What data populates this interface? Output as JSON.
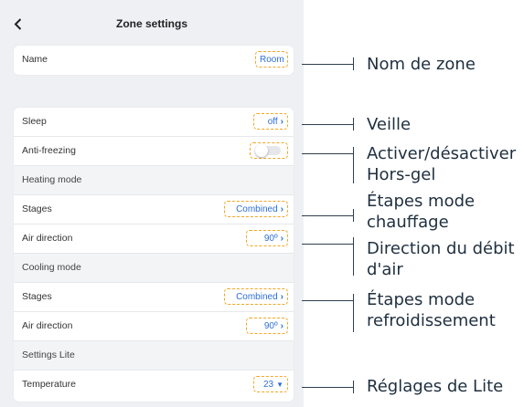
{
  "header": {
    "title": "Zone settings",
    "back_icon": "chevron-left-icon"
  },
  "name_row": {
    "label": "Name",
    "value": "Room"
  },
  "sleep": {
    "label": "Sleep",
    "value": "off"
  },
  "antifreeze": {
    "label": "Anti-freezing",
    "on": false
  },
  "heating": {
    "section": "Heating mode",
    "stages": {
      "label": "Stages",
      "value": "Combined"
    },
    "air": {
      "label": "Air direction",
      "value": "90º"
    }
  },
  "cooling": {
    "section": "Cooling mode",
    "stages": {
      "label": "Stages",
      "value": "Combined"
    },
    "air": {
      "label": "Air direction",
      "value": "90º"
    }
  },
  "lite": {
    "section": "Settings Lite",
    "temperature": {
      "label": "Temperature",
      "value": "23"
    }
  },
  "annotations": {
    "zone_name": "Nom de zone",
    "sleep": "Veille",
    "antifreeze_1": "Activer/désactiver",
    "antifreeze_2": "Hors-gel",
    "heat_stages_1": "Étapes mode",
    "heat_stages_2": "chauffage",
    "air_dir_1": "Direction du débit",
    "air_dir_2": "d'air",
    "cool_stages_1": "Étapes mode",
    "cool_stages_2": "refroidissement",
    "lite": "Réglages de Lite"
  },
  "colors": {
    "accent": "#2f6fd6",
    "highlight": "#f5a623",
    "background": "#eef0f4",
    "annotation": "#1f2f3f"
  }
}
